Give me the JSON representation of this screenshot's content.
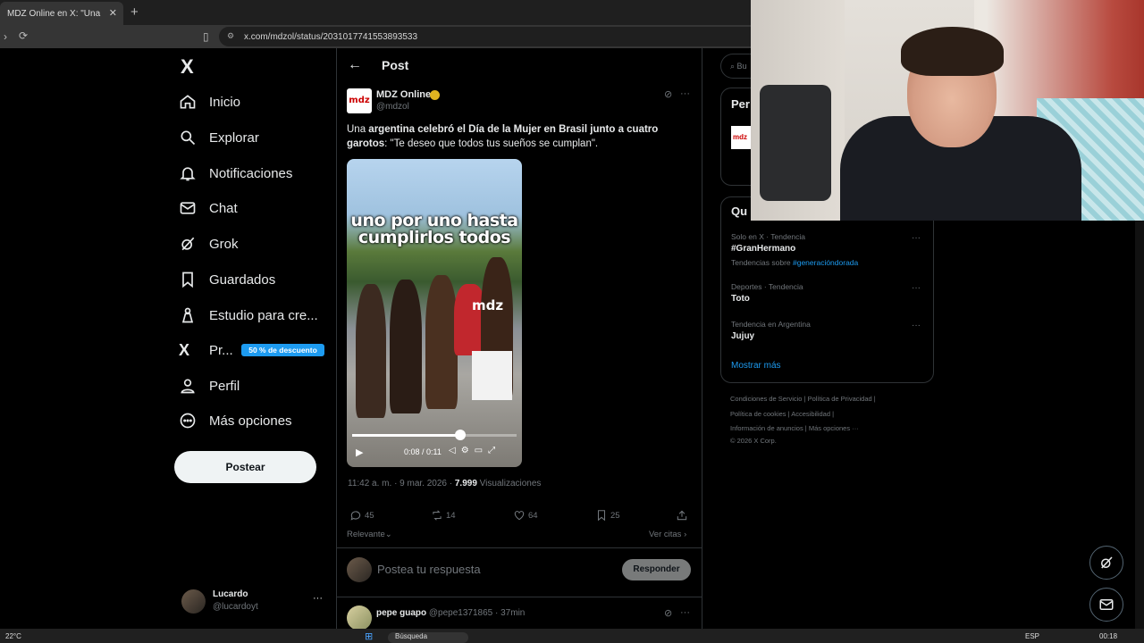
{
  "browser": {
    "tab_title": "MDZ Online en X: \"Una argen",
    "url": "x.com/mdzol/status/2031017741553893533"
  },
  "nav": {
    "logo": "X",
    "items": [
      {
        "label": "Inicio",
        "icon": "home-icon"
      },
      {
        "label": "Explorar",
        "icon": "search-icon"
      },
      {
        "label": "Notificaciones",
        "icon": "bell-icon"
      },
      {
        "label": "Chat",
        "icon": "mail-icon"
      },
      {
        "label": "Grok",
        "icon": "grok-icon"
      },
      {
        "label": "Guardados",
        "icon": "bookmark-icon"
      },
      {
        "label": "Estudio para cre...",
        "icon": "creator-studio-icon"
      },
      {
        "label": "Pr...",
        "icon": "x-premium-icon"
      },
      {
        "label": "Perfil",
        "icon": "user-icon"
      },
      {
        "label": "Más opciones",
        "icon": "more-circle-icon"
      }
    ],
    "premium_badge": "50 % de descuento",
    "post_button": "Postear",
    "profile_name": "Lucardo",
    "profile_handle": "@lucardoyt"
  },
  "header": {
    "back": "←",
    "title": "Post"
  },
  "tweet": {
    "author": "MDZ Online",
    "handle": "@mdzol",
    "logo_text": "mdz",
    "text_pre": "Una ",
    "text_b1": "argentina celebró el Día de la Mujer en Brasil junto a cuatro garotos",
    "text_post": ": \"Te deseo que todos tus sueños se cumplan\".",
    "video_caption": "uno por uno hasta cumplirlos todos",
    "video_watermark": "mdz",
    "video_time": "0:08 / 0:11",
    "video_progress": 0.66,
    "meta_date": "11:42 a. m. · 9 mar. 2026 · ",
    "views": "7.999",
    "views_label": " Visualizaciones",
    "replies": "45",
    "reposts": "14",
    "likes": "64",
    "bookmarks": "25",
    "sort": "Relevante",
    "quotes": "Ver citas"
  },
  "reply": {
    "placeholder": "Postea tu respuesta",
    "button": "Responder",
    "next_name": "pepe guapo",
    "next_meta": " @pepe1371865 · 37min"
  },
  "right": {
    "search": "Bu",
    "premium_title": "Per",
    "trends_title": "Qu",
    "trends": [
      {
        "meta": "Solo en X · Tendencia",
        "name": "#GranHermano"
      },
      {
        "meta": "Deportes · Tendencia",
        "name": "Toto"
      },
      {
        "meta": "Tendencia en Argentina",
        "name": "Jujuy"
      }
    ],
    "trend_sub_pre": "Tendencias sobre ",
    "trend_sub_tag": "#generacióndorada",
    "show_more": "Mostrar más",
    "footer": [
      "Condiciones de Servicio  |   Política de Privacidad  |",
      "Política de cookies  |   Accesibilidad  |",
      "Información de anuncios  |   Más opciones ···",
      "© 2026 X Corp."
    ]
  },
  "taskbar": {
    "weather": "22°C",
    "search": "Búsqueda",
    "lang": "ESP",
    "time": "00:18"
  }
}
